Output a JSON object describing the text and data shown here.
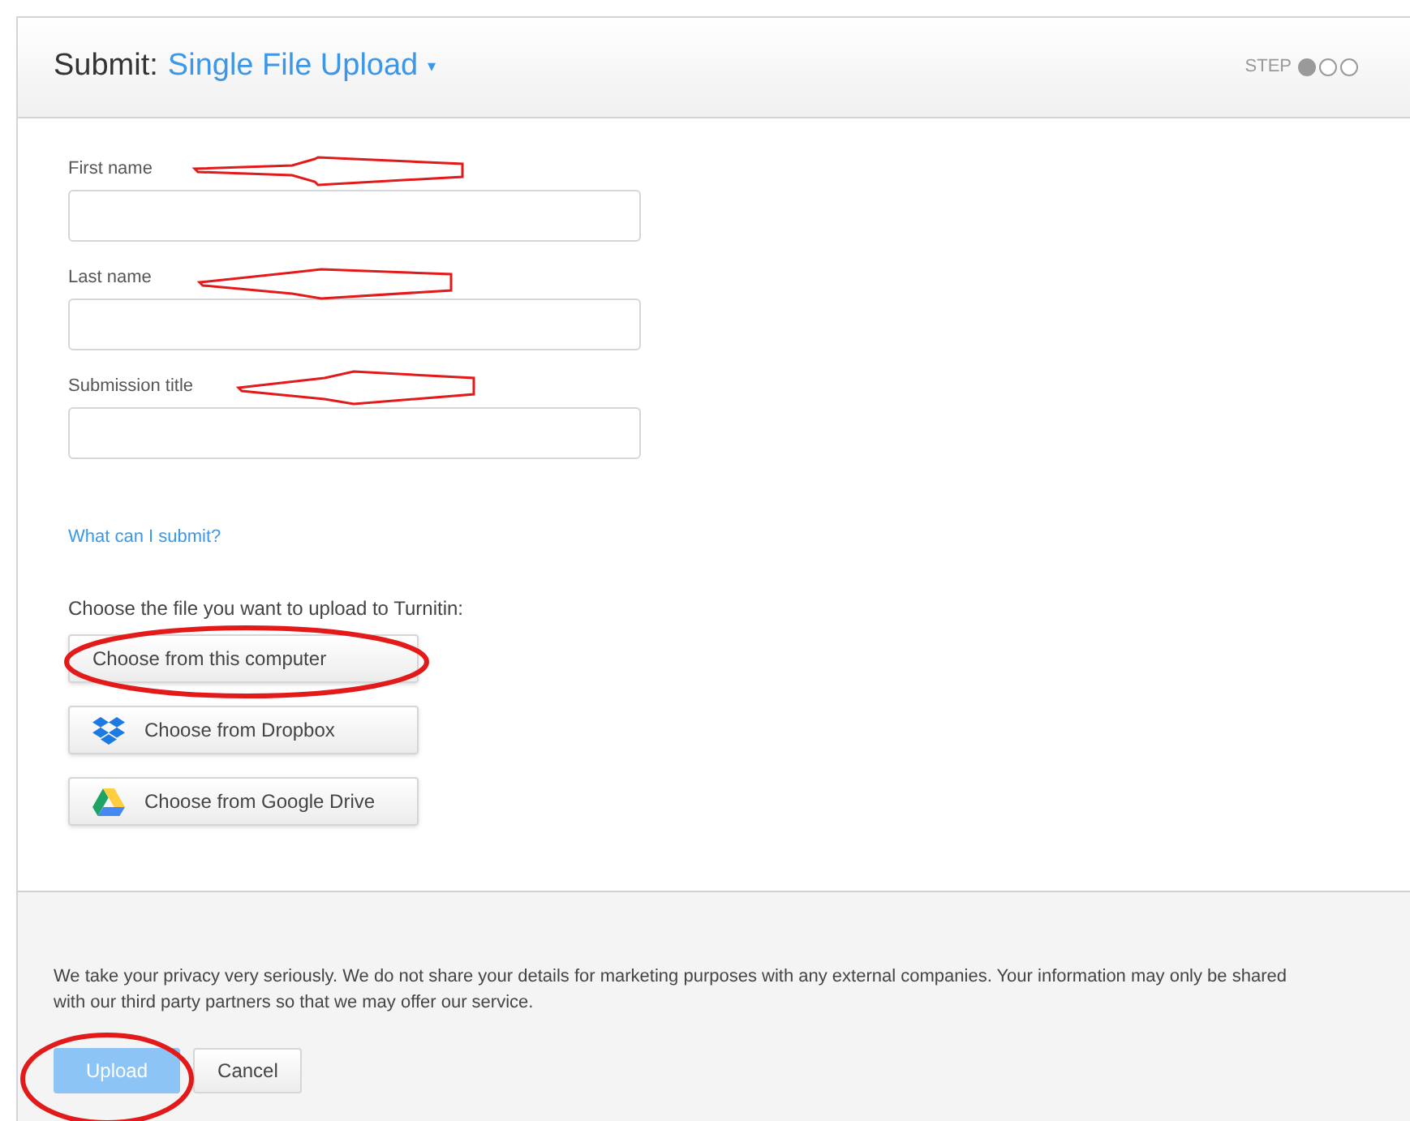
{
  "header": {
    "prefix": "Submit:",
    "title": "Single File Upload",
    "caret": "▾",
    "step_label": "STEP",
    "steps": [
      {
        "filled": true
      },
      {
        "filled": false
      },
      {
        "filled": false
      }
    ]
  },
  "fields": [
    {
      "label": "First name"
    },
    {
      "label": "Last name"
    },
    {
      "label": "Submission title"
    }
  ],
  "help_link": "What can I submit?",
  "choose_prompt": "Choose the file you want to upload to Turnitin:",
  "sources": [
    {
      "kind": "computer",
      "label": "Choose from this computer"
    },
    {
      "kind": "dropbox",
      "label": "Choose from Dropbox"
    },
    {
      "kind": "gdrive",
      "label": "Choose from Google Drive"
    }
  ],
  "privacy": "We take your privacy very seriously. We do not share your details for marketing purposes with any external companies. Your information may only be shared with our third party partners so that we may offer our service.",
  "buttons": [
    {
      "label": "Upload",
      "disabled": true
    },
    {
      "label": "Cancel",
      "disabled": false
    }
  ]
}
